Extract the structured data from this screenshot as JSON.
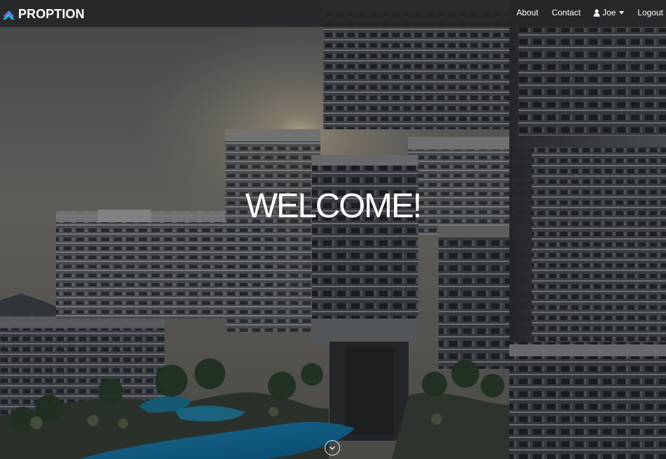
{
  "app": {
    "brand": "PROPTION",
    "logo_icon": "chevron-stack-logo",
    "accent_colors": [
      "#8f5bd1",
      "#16c7e8"
    ]
  },
  "navigation": {
    "about": "About",
    "contact": "Contact",
    "user_name": "Joe",
    "user_icon": "person-icon",
    "user_menu_icon": "caret-down-icon",
    "logout": "Logout"
  },
  "hero": {
    "heading": "WELCOME!",
    "scroll_icon": "chevron-down-icon"
  },
  "colors": {
    "navbar": "#252628",
    "text": "#ffffff",
    "pool": "#168fd0",
    "overlay": "#000000"
  }
}
